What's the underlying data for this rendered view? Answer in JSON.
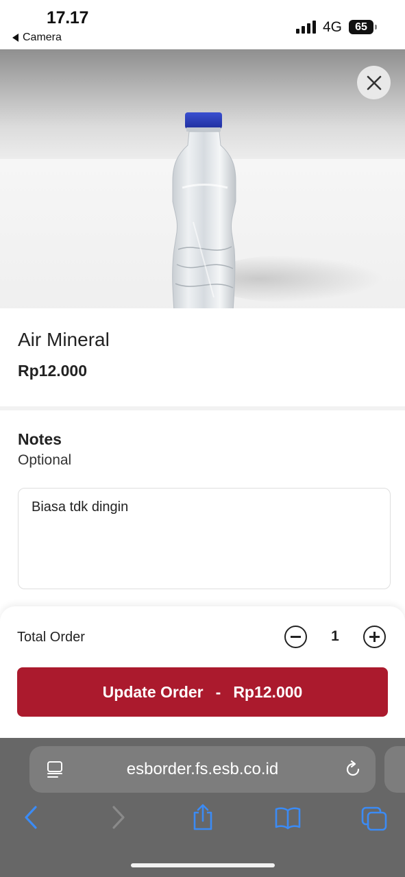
{
  "status_bar": {
    "time": "17.17",
    "back_app": "Camera",
    "network": "4G",
    "battery": "65"
  },
  "product": {
    "name": "Air Mineral",
    "price": "Rp12.000",
    "image_icon": "water-bottle-image"
  },
  "notes": {
    "title": "Notes",
    "subtitle": "Optional",
    "value": "Biasa tdk dingin"
  },
  "order": {
    "total_label": "Total Order",
    "quantity": "1",
    "button_label": "Update Order",
    "button_separator": "-",
    "button_price": "Rp12.000"
  },
  "browser": {
    "url": "esborder.fs.esb.co.id"
  },
  "colors": {
    "primary": "#ab1a2d",
    "browser_bg": "#676767",
    "toolbar_icon": "#3b8bf5",
    "toolbar_icon_disabled": "#8a8a8a"
  },
  "icons": {
    "close": "close-icon",
    "minus": "minus-circle-icon",
    "plus": "plus-circle-icon",
    "reader": "reader-mode-icon",
    "reload": "reload-icon",
    "back": "chevron-left-icon",
    "forward": "chevron-right-icon",
    "share": "share-icon",
    "bookmarks": "book-icon",
    "tabs": "tabs-icon"
  }
}
